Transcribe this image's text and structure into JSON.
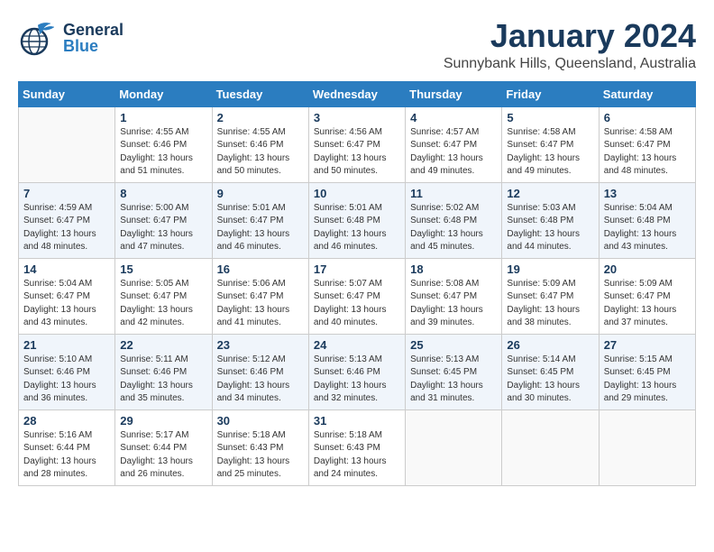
{
  "header": {
    "logo_general": "General",
    "logo_blue": "Blue",
    "month": "January 2024",
    "location": "Sunnybank Hills, Queensland, Australia"
  },
  "weekdays": [
    "Sunday",
    "Monday",
    "Tuesday",
    "Wednesday",
    "Thursday",
    "Friday",
    "Saturday"
  ],
  "weeks": [
    [
      {
        "day": "",
        "info": ""
      },
      {
        "day": "1",
        "info": "Sunrise: 4:55 AM\nSunset: 6:46 PM\nDaylight: 13 hours\nand 51 minutes."
      },
      {
        "day": "2",
        "info": "Sunrise: 4:55 AM\nSunset: 6:46 PM\nDaylight: 13 hours\nand 50 minutes."
      },
      {
        "day": "3",
        "info": "Sunrise: 4:56 AM\nSunset: 6:47 PM\nDaylight: 13 hours\nand 50 minutes."
      },
      {
        "day": "4",
        "info": "Sunrise: 4:57 AM\nSunset: 6:47 PM\nDaylight: 13 hours\nand 49 minutes."
      },
      {
        "day": "5",
        "info": "Sunrise: 4:58 AM\nSunset: 6:47 PM\nDaylight: 13 hours\nand 49 minutes."
      },
      {
        "day": "6",
        "info": "Sunrise: 4:58 AM\nSunset: 6:47 PM\nDaylight: 13 hours\nand 48 minutes."
      }
    ],
    [
      {
        "day": "7",
        "info": "Sunrise: 4:59 AM\nSunset: 6:47 PM\nDaylight: 13 hours\nand 48 minutes."
      },
      {
        "day": "8",
        "info": "Sunrise: 5:00 AM\nSunset: 6:47 PM\nDaylight: 13 hours\nand 47 minutes."
      },
      {
        "day": "9",
        "info": "Sunrise: 5:01 AM\nSunset: 6:47 PM\nDaylight: 13 hours\nand 46 minutes."
      },
      {
        "day": "10",
        "info": "Sunrise: 5:01 AM\nSunset: 6:48 PM\nDaylight: 13 hours\nand 46 minutes."
      },
      {
        "day": "11",
        "info": "Sunrise: 5:02 AM\nSunset: 6:48 PM\nDaylight: 13 hours\nand 45 minutes."
      },
      {
        "day": "12",
        "info": "Sunrise: 5:03 AM\nSunset: 6:48 PM\nDaylight: 13 hours\nand 44 minutes."
      },
      {
        "day": "13",
        "info": "Sunrise: 5:04 AM\nSunset: 6:48 PM\nDaylight: 13 hours\nand 43 minutes."
      }
    ],
    [
      {
        "day": "14",
        "info": "Sunrise: 5:04 AM\nSunset: 6:47 PM\nDaylight: 13 hours\nand 43 minutes."
      },
      {
        "day": "15",
        "info": "Sunrise: 5:05 AM\nSunset: 6:47 PM\nDaylight: 13 hours\nand 42 minutes."
      },
      {
        "day": "16",
        "info": "Sunrise: 5:06 AM\nSunset: 6:47 PM\nDaylight: 13 hours\nand 41 minutes."
      },
      {
        "day": "17",
        "info": "Sunrise: 5:07 AM\nSunset: 6:47 PM\nDaylight: 13 hours\nand 40 minutes."
      },
      {
        "day": "18",
        "info": "Sunrise: 5:08 AM\nSunset: 6:47 PM\nDaylight: 13 hours\nand 39 minutes."
      },
      {
        "day": "19",
        "info": "Sunrise: 5:09 AM\nSunset: 6:47 PM\nDaylight: 13 hours\nand 38 minutes."
      },
      {
        "day": "20",
        "info": "Sunrise: 5:09 AM\nSunset: 6:47 PM\nDaylight: 13 hours\nand 37 minutes."
      }
    ],
    [
      {
        "day": "21",
        "info": "Sunrise: 5:10 AM\nSunset: 6:46 PM\nDaylight: 13 hours\nand 36 minutes."
      },
      {
        "day": "22",
        "info": "Sunrise: 5:11 AM\nSunset: 6:46 PM\nDaylight: 13 hours\nand 35 minutes."
      },
      {
        "day": "23",
        "info": "Sunrise: 5:12 AM\nSunset: 6:46 PM\nDaylight: 13 hours\nand 34 minutes."
      },
      {
        "day": "24",
        "info": "Sunrise: 5:13 AM\nSunset: 6:46 PM\nDaylight: 13 hours\nand 32 minutes."
      },
      {
        "day": "25",
        "info": "Sunrise: 5:13 AM\nSunset: 6:45 PM\nDaylight: 13 hours\nand 31 minutes."
      },
      {
        "day": "26",
        "info": "Sunrise: 5:14 AM\nSunset: 6:45 PM\nDaylight: 13 hours\nand 30 minutes."
      },
      {
        "day": "27",
        "info": "Sunrise: 5:15 AM\nSunset: 6:45 PM\nDaylight: 13 hours\nand 29 minutes."
      }
    ],
    [
      {
        "day": "28",
        "info": "Sunrise: 5:16 AM\nSunset: 6:44 PM\nDaylight: 13 hours\nand 28 minutes."
      },
      {
        "day": "29",
        "info": "Sunrise: 5:17 AM\nSunset: 6:44 PM\nDaylight: 13 hours\nand 26 minutes."
      },
      {
        "day": "30",
        "info": "Sunrise: 5:18 AM\nSunset: 6:43 PM\nDaylight: 13 hours\nand 25 minutes."
      },
      {
        "day": "31",
        "info": "Sunrise: 5:18 AM\nSunset: 6:43 PM\nDaylight: 13 hours\nand 24 minutes."
      },
      {
        "day": "",
        "info": ""
      },
      {
        "day": "",
        "info": ""
      },
      {
        "day": "",
        "info": ""
      }
    ]
  ]
}
